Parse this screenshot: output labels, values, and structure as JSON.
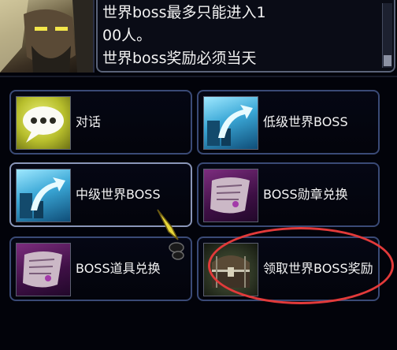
{
  "npc": {
    "portrait_icon": "npc-portrait",
    "dialog_lines": [
      "世界boss最多只能进入1",
      "00人。",
      "世界boss奖励必须当天"
    ]
  },
  "menu": {
    "options": [
      {
        "label": "对话",
        "icon": "speech-bubble-icon"
      },
      {
        "label": "低级世界BOSS",
        "icon": "portal-arrow-icon"
      },
      {
        "label": "中级世界BOSS",
        "icon": "portal-arrow-icon"
      },
      {
        "label": "BOSS勋章兑换",
        "icon": "scroll-icon"
      },
      {
        "label": "BOSS道具兑换",
        "icon": "scroll-icon"
      },
      {
        "label": "领取世界BOSS奖励",
        "icon": "treasure-chest-icon"
      }
    ]
  },
  "colors": {
    "panel_border": "#3a4a76",
    "highlight_circle": "#e23a3a",
    "text": "#f4f4f4"
  }
}
